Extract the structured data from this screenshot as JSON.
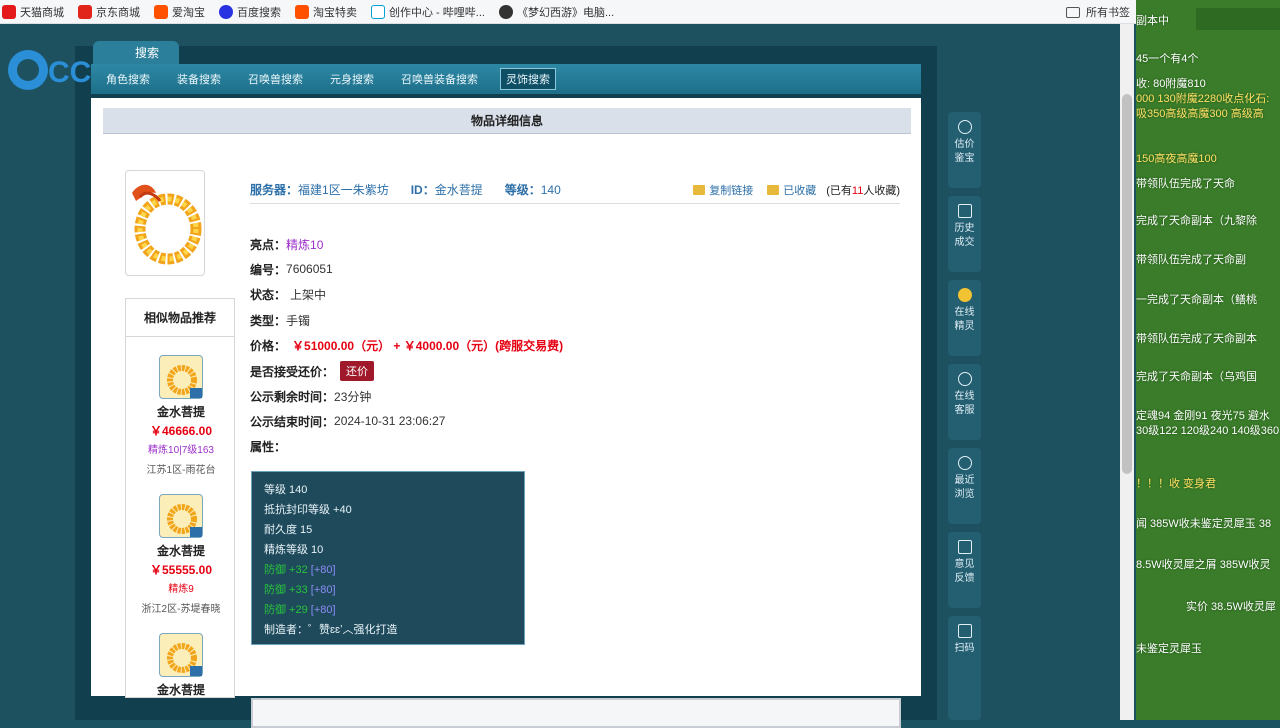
{
  "bookmarks": [
    {
      "label": "天猫商城",
      "color": "#e41a1a"
    },
    {
      "label": "京东商城",
      "color": "#e1251b"
    },
    {
      "label": "爱淘宝",
      "color": "#ff5000"
    },
    {
      "label": "百度搜索",
      "color": "#2932e1"
    },
    {
      "label": "淘宝特卖",
      "color": "#ff5000"
    },
    {
      "label": "创作中心 - 哔哩哔...",
      "color": "#00a1d6"
    },
    {
      "label": "《梦幻西游》电脑...",
      "color": "#333333"
    }
  ],
  "all_bookmarks": "所有书签",
  "search_tab": "搜索",
  "nav": [
    "角色搜索",
    "装备搜索",
    "召唤兽搜索",
    "元身搜索",
    "召唤兽装备搜索",
    "灵饰搜索"
  ],
  "panel_title": "物品详细信息",
  "info": {
    "server_label": "服务器：",
    "server": "福建1区一朱紫坊",
    "id_label": "ID：",
    "id": "金水菩提",
    "level_label": "等级：",
    "level": "140",
    "copy_link": "复制链接",
    "favorited": "已收藏",
    "fav_prefix": "(已有",
    "fav_num": "11",
    "fav_suffix": "人收藏)"
  },
  "details": {
    "highlight_k": "亮点：",
    "highlight_v": "精炼10",
    "serial_k": "编号：",
    "serial_v": "7606051",
    "status_k": "状态：",
    "status_v": "上架中",
    "type_k": "类型：",
    "type_v": "手镯",
    "price_k": "价格：",
    "price_v": "￥51000.00（元） + ￥4000.00（元）(跨服交易费)",
    "counter_k": "是否接受还价：",
    "counter_btn": "还价",
    "remain_k": "公示剩余时间：",
    "remain_v": "23分钟",
    "end_k": "公示结束时间：",
    "end_v": "2024-10-31 23:06:27",
    "attr_k": "属性："
  },
  "attrs": {
    "a1": "等级 140",
    "a2": "抵抗封印等级 +40",
    "a3": "耐久度 15",
    "a4": "精炼等级 10",
    "g1": "防御 +32",
    "b1": "[+80]",
    "g2": "防御 +33",
    "b2": "[+80]",
    "g3": "防御 +29",
    "b3": "[+80]",
    "maker": "制造者：゜赞ɛɛʼ︿强化打造"
  },
  "similar": {
    "title": "相似物品推荐",
    "items": [
      {
        "name": "金水菩提",
        "price": "￥46666.00",
        "tag": "精炼10|7级163",
        "server": "江苏1区-雨花台"
      },
      {
        "name": "金水菩提",
        "price": "￥55555.00",
        "tag": "精炼9",
        "server": "浙江2区-苏堤春晓"
      },
      {
        "name": "金水菩提",
        "price": "",
        "tag": "",
        "server": ""
      }
    ]
  },
  "tools": [
    {
      "label": "估价\n鉴宝"
    },
    {
      "label": "历史\n成交"
    },
    {
      "label": "在线\n精灵"
    },
    {
      "label": "在线\n客服"
    },
    {
      "label": "最近\n浏览"
    },
    {
      "label": "意见\n反馈"
    },
    {
      "label": "扫码"
    }
  ],
  "cc_logo": "CC直播",
  "chat": [
    {
      "text": "副本中",
      "cls": "cyellow"
    },
    {
      "text": "45一个有4个",
      "cls": ""
    },
    {
      "text": "收: 80附魔810",
      "cls": ""
    },
    {
      "text": "000 130附魔2280收点化石:",
      "cls": "cyellow"
    },
    {
      "text": "吸350高级高魔300 高级高",
      "cls": "cyellow"
    },
    {
      "text": "150高夜高魔100",
      "cls": "cyellow"
    },
    {
      "text": "带领队伍完成了天命",
      "cls": ""
    },
    {
      "text": "完成了天命副本（九黎除",
      "cls": ""
    },
    {
      "text": "带领队伍完成了天命副",
      "cls": ""
    },
    {
      "text": "一完成了天命副本（鳝桃",
      "cls": ""
    },
    {
      "text": "带领队伍完成了天命副本",
      "cls": ""
    },
    {
      "text": "完成了天命副本（乌鸡国",
      "cls": ""
    },
    {
      "text": "定魂94 金刚91 夜光75 避水",
      "cls": ""
    },
    {
      "text": "30级122 120级240 140级360",
      "cls": ""
    },
    {
      "text": "！！！收 变身君",
      "cls": "cyellow"
    },
    {
      "text": "闻 385W收未鉴定灵犀玉 38",
      "cls": ""
    },
    {
      "text": "8.5W收灵犀之屑 385W收灵",
      "cls": ""
    },
    {
      "text": "实价 38.5W收灵犀",
      "cls": ""
    },
    {
      "text": "未鉴定灵犀玉",
      "cls": ""
    }
  ]
}
